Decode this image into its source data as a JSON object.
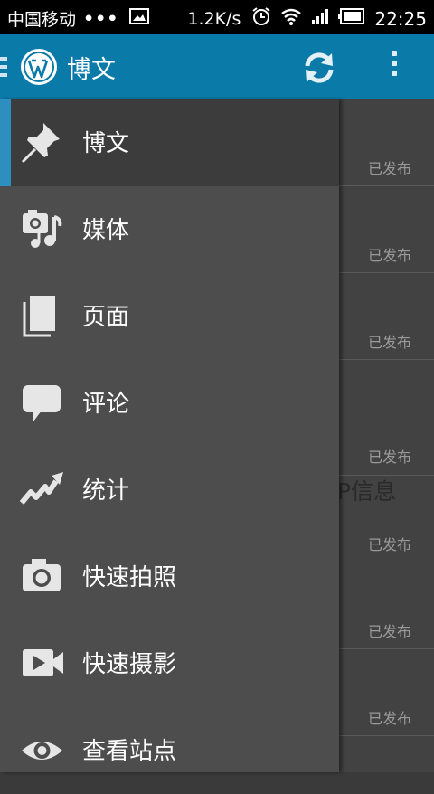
{
  "status_bar": {
    "carrier": "中国移动",
    "dots": "•••",
    "speed": "1.2K/s",
    "time": "22:25"
  },
  "action_bar": {
    "title": "博文",
    "logo_icon": "wordpress-logo-icon",
    "refresh_icon": "refresh-icon",
    "overflow_icon": "overflow-menu-icon",
    "accent_color": "#0a7aa8"
  },
  "drawer": {
    "items": [
      {
        "label": "博文",
        "icon": "pin-icon",
        "active": true
      },
      {
        "label": "媒体",
        "icon": "media-icon",
        "active": false
      },
      {
        "label": "页面",
        "icon": "pages-icon",
        "active": false
      },
      {
        "label": "评论",
        "icon": "comment-icon",
        "active": false
      },
      {
        "label": "统计",
        "icon": "stats-icon",
        "active": false
      },
      {
        "label": "快速拍照",
        "icon": "camera-icon",
        "active": false
      },
      {
        "label": "快速摄影",
        "icon": "video-icon",
        "active": false
      },
      {
        "label": "查看站点",
        "icon": "eye-icon",
        "active": false
      }
    ],
    "active_indicator_color": "#2c8fbf"
  },
  "post_list": {
    "partial_title": "P信息",
    "rows": [
      {
        "status": "已发布"
      },
      {
        "status": "已发布"
      },
      {
        "status": "已发布"
      },
      {
        "status": "已发布"
      },
      {
        "status": "已发布"
      },
      {
        "status": "已发布"
      },
      {
        "status": "已发布"
      }
    ]
  }
}
